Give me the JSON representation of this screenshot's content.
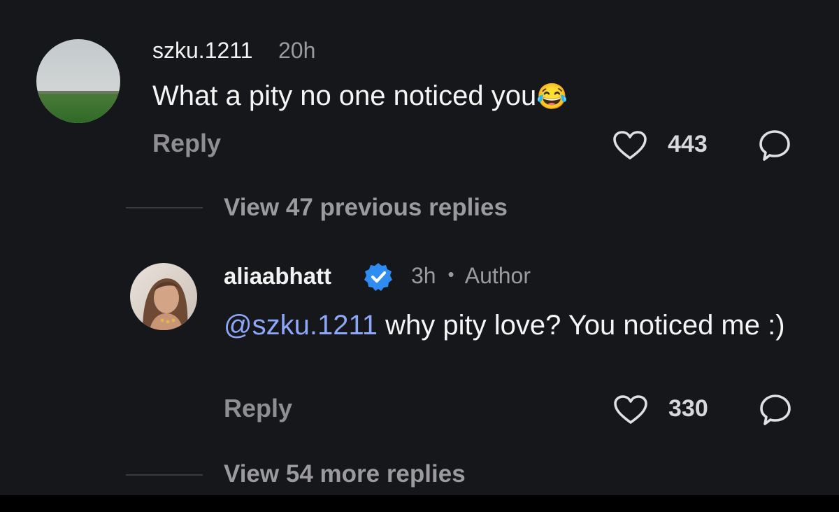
{
  "comments": [
    {
      "username": "szku.1211",
      "time": "20h",
      "text": "What a pity no one noticed you",
      "emoji": "😂",
      "reply_label": "Reply",
      "likes": "443",
      "icons": [
        "heart-icon",
        "comment-icon"
      ]
    },
    {
      "username": "aliaabhatt",
      "verified": true,
      "time": "3h",
      "separator": "•",
      "author_label": "Author",
      "mention": "@szku.1211",
      "text": " why pity love? You noticed me :)",
      "reply_label": "Reply",
      "likes": "330",
      "icons": [
        "heart-icon",
        "comment-icon"
      ]
    }
  ],
  "thread": {
    "view_previous_label": "View 47 previous replies",
    "view_more_label": "View 54 more replies"
  },
  "colors": {
    "background": "#16171b",
    "mention": "#8da6f8",
    "verified_badge": "#2f8cf0"
  }
}
